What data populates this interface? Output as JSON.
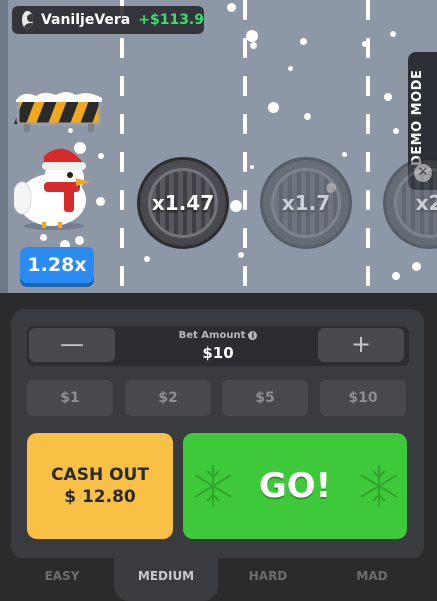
{
  "player": {
    "name": "VaniljeVera",
    "balance": "+$113.9"
  },
  "demo": {
    "label": "DEMO MODE",
    "close_glyph": "✕"
  },
  "road": {
    "current_multiplier": "1.28x",
    "upcoming_multipliers": [
      "x1.47",
      "x1.7",
      "x2"
    ]
  },
  "bet": {
    "label": "Bet Amount",
    "info_glyph": "i",
    "value": "$10",
    "decrease_glyph": "—",
    "increase_glyph": "+",
    "quick_amounts": [
      "$1",
      "$2",
      "$5",
      "$10"
    ]
  },
  "actions": {
    "cashout_line1": "CASH OUT",
    "cashout_line2": "$ 12.80",
    "go_label": "GO!"
  },
  "difficulty": {
    "options": [
      "EASY",
      "MEDIUM",
      "HARD",
      "MAD"
    ],
    "selected": "MEDIUM"
  },
  "colors": {
    "cashout": "#f8c044",
    "go": "#3ec93a",
    "multiplier_badge": "#2a8cf2",
    "balance_positive": "#36e06a"
  }
}
